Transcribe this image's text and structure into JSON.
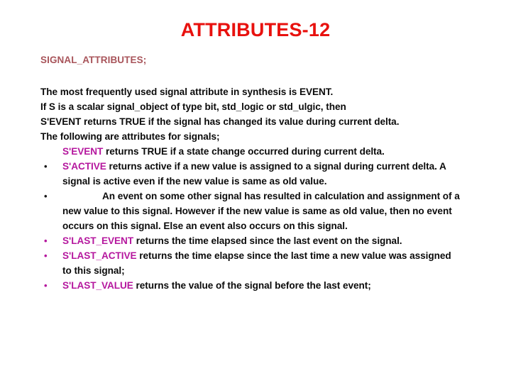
{
  "slide": {
    "title": "ATTRIBUTES-12",
    "subtitle": "SIGNAL_ATTRIBUTES;",
    "colors": {
      "title": "#e8110e",
      "subtitle": "#a8545a",
      "keyword": "#b5179e",
      "body": "#0b0b0b",
      "background": "#ffffff"
    },
    "paragraphs": [
      "The most frequently used signal attribute in synthesis is EVENT.",
      "If S is a  scalar signal_object of type bit, std_logic or std_ulgic, then",
      "S'EVENT returns TRUE if the signal has changed its value during current delta.",
      "The following are  attributes for signals;"
    ],
    "sub_line": {
      "keyword": "S'EVENT",
      "text": " returns TRUE if a state change occurred during current delta."
    },
    "bullets": [
      {
        "marker": "•",
        "marker_color": "dark",
        "keyword": "S'ACTIVE",
        "lines": [
          " returns  active if a new value is assigned to a signal during current  delta. A",
          "signal is active even if the new value is same as old value."
        ]
      },
      {
        "marker": "•",
        "marker_color": "dark",
        "keyword": "",
        "lines": [
          "An event on some other signal has resulted in calculation and assignment of a",
          "new value to this signal. However if the new value is same as old value, then no event",
          "occurs on this signal. Else an event also occurs on this signal."
        ],
        "leading_tab": true
      },
      {
        "marker": "•",
        "marker_color": "magenta",
        "keyword": "S'LAST_EVENT",
        "lines": [
          " returns the time elapsed since the last event on the signal."
        ]
      },
      {
        "marker": "•",
        "marker_color": "magenta",
        "keyword": "S'LAST_ACTIVE",
        "lines": [
          " returns the time elapse since the last time a new value was assigned",
          "to this signal;"
        ]
      },
      {
        "marker": "•",
        "marker_color": "magenta",
        "keyword": "S'LAST_VALUE",
        "lines": [
          " returns the value of the signal before the last event;"
        ]
      }
    ]
  }
}
